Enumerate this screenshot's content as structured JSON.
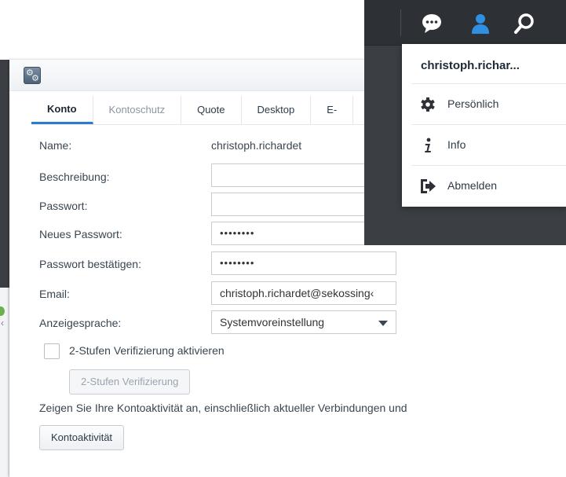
{
  "app": {
    "icon": "gears-icon"
  },
  "tabs": [
    {
      "label": "Konto",
      "state": "active"
    },
    {
      "label": "Kontoschutz",
      "state": "muted"
    },
    {
      "label": "Quote",
      "state": "normal"
    },
    {
      "label": "Desktop",
      "state": "normal"
    },
    {
      "label": "E-",
      "state": "normal"
    }
  ],
  "form": {
    "name_label": "Name:",
    "name_value": "christoph.richardet",
    "description_label": "Beschreibung:",
    "description_value": "",
    "password_label": "Passwort:",
    "password_value": "",
    "new_password_label": "Neues Passwort:",
    "new_password_value": "••••••••",
    "confirm_password_label": "Passwort bestätigen:",
    "confirm_password_value": "••••••••",
    "email_label": "Email:",
    "email_value": "christoph.richardet@sekossing‹",
    "language_label": "Anzeigesprache:",
    "language_value": "Systemvoreinstellung"
  },
  "two_step": {
    "checkbox_label": "2-Stufen Verifizierung aktivieren",
    "checked": false,
    "button_label": "2-Stufen Verifizierung"
  },
  "activity": {
    "text": "Zeigen Sie Ihre Kontoaktivität an, einschließlich aktueller Verbindungen und",
    "button_label": "Kontoaktivität"
  },
  "topbar": {
    "icons": [
      "chat-bubble-icon",
      "user-icon",
      "search-icon"
    ]
  },
  "user_menu": {
    "username": "christoph.richar...",
    "items": [
      {
        "label": "Persönlich",
        "icon": "gear-icon"
      },
      {
        "label": "Info",
        "icon": "info-icon"
      },
      {
        "label": "Abmelden",
        "icon": "logout-icon"
      }
    ]
  },
  "colors": {
    "accent": "#2f7cc9",
    "user_icon": "#2f8fe0",
    "dark_bg": "#3b3e43",
    "topbar_bg": "#2d3035"
  }
}
